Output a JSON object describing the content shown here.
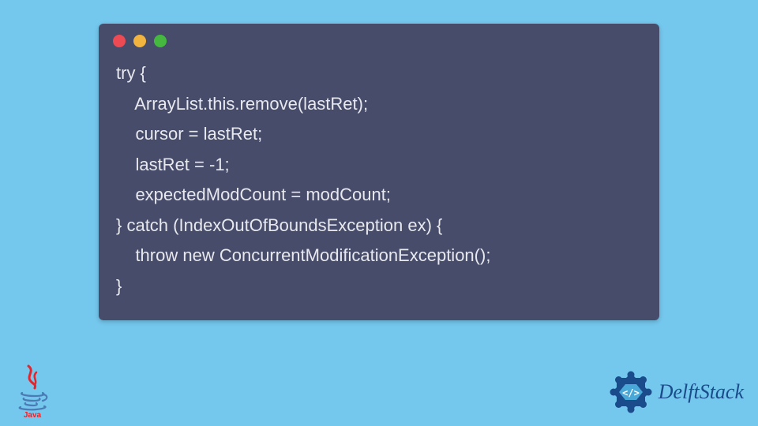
{
  "code": {
    "lines": [
      "try {",
      "    ArrayList.this.remove(lastRet);",
      "    cursor = lastRet;",
      "    lastRet = -1;",
      "    expectedModCount = modCount;",
      "} catch (IndexOutOfBoundsException ex) {",
      "    throw new ConcurrentModificationException();",
      "}"
    ]
  },
  "window": {
    "dots": [
      "red",
      "yellow",
      "green"
    ]
  },
  "logos": {
    "java_label": "Java",
    "delft_label": "DelftStack"
  },
  "colors": {
    "page_bg": "#74c7ed",
    "window_bg": "#474c6b",
    "code_text": "#e8e9ee",
    "dot_red": "#ee4a53",
    "dot_yellow": "#f2b43e",
    "dot_green": "#45b93f",
    "delft_blue": "#1a4b8a"
  }
}
